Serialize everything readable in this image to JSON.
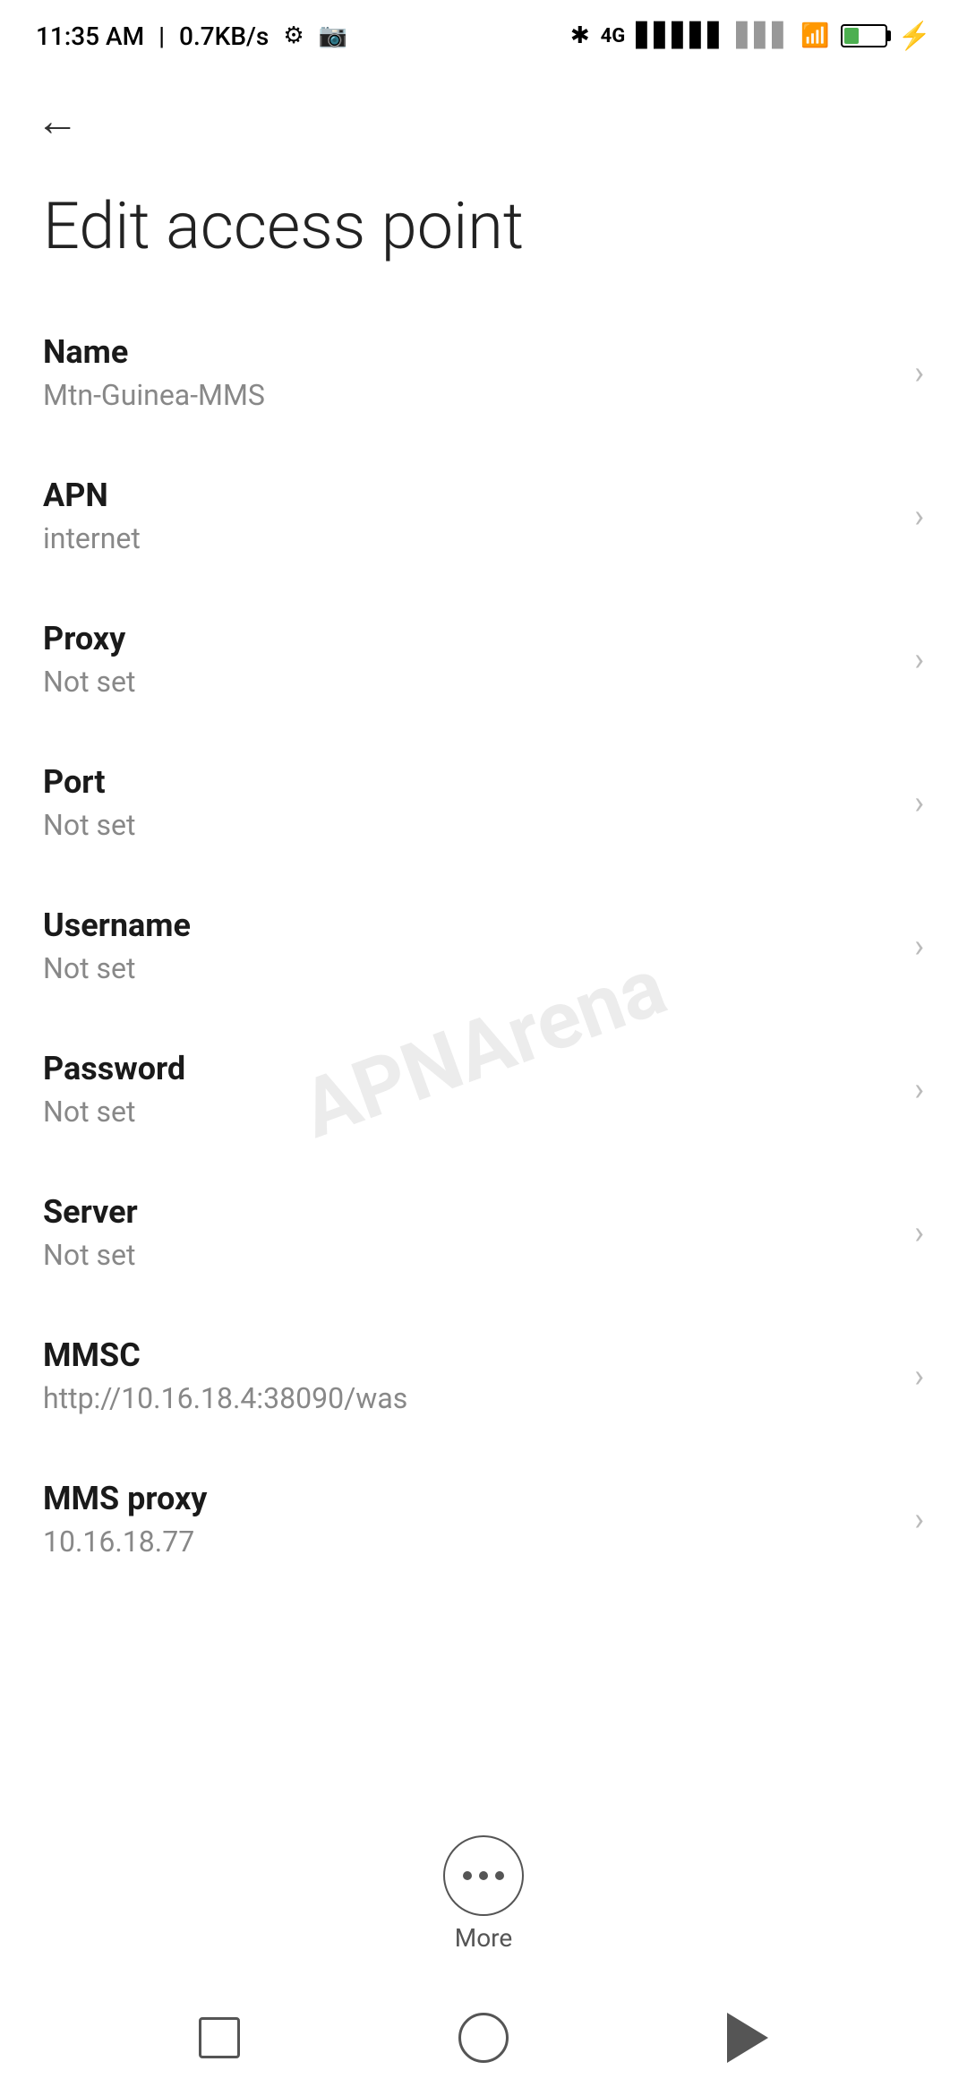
{
  "statusBar": {
    "time": "11:35 AM",
    "speed": "0.7KB/s"
  },
  "navigation": {
    "backLabel": "←"
  },
  "pageTitle": "Edit access point",
  "settings": [
    {
      "label": "Name",
      "value": "Mtn-Guinea-MMS"
    },
    {
      "label": "APN",
      "value": "internet"
    },
    {
      "label": "Proxy",
      "value": "Not set"
    },
    {
      "label": "Port",
      "value": "Not set"
    },
    {
      "label": "Username",
      "value": "Not set"
    },
    {
      "label": "Password",
      "value": "Not set"
    },
    {
      "label": "Server",
      "value": "Not set"
    },
    {
      "label": "MMSC",
      "value": "http://10.16.18.4:38090/was"
    },
    {
      "label": "MMS proxy",
      "value": "10.16.18.77"
    }
  ],
  "more": {
    "label": "More"
  },
  "watermark": "APNArena"
}
